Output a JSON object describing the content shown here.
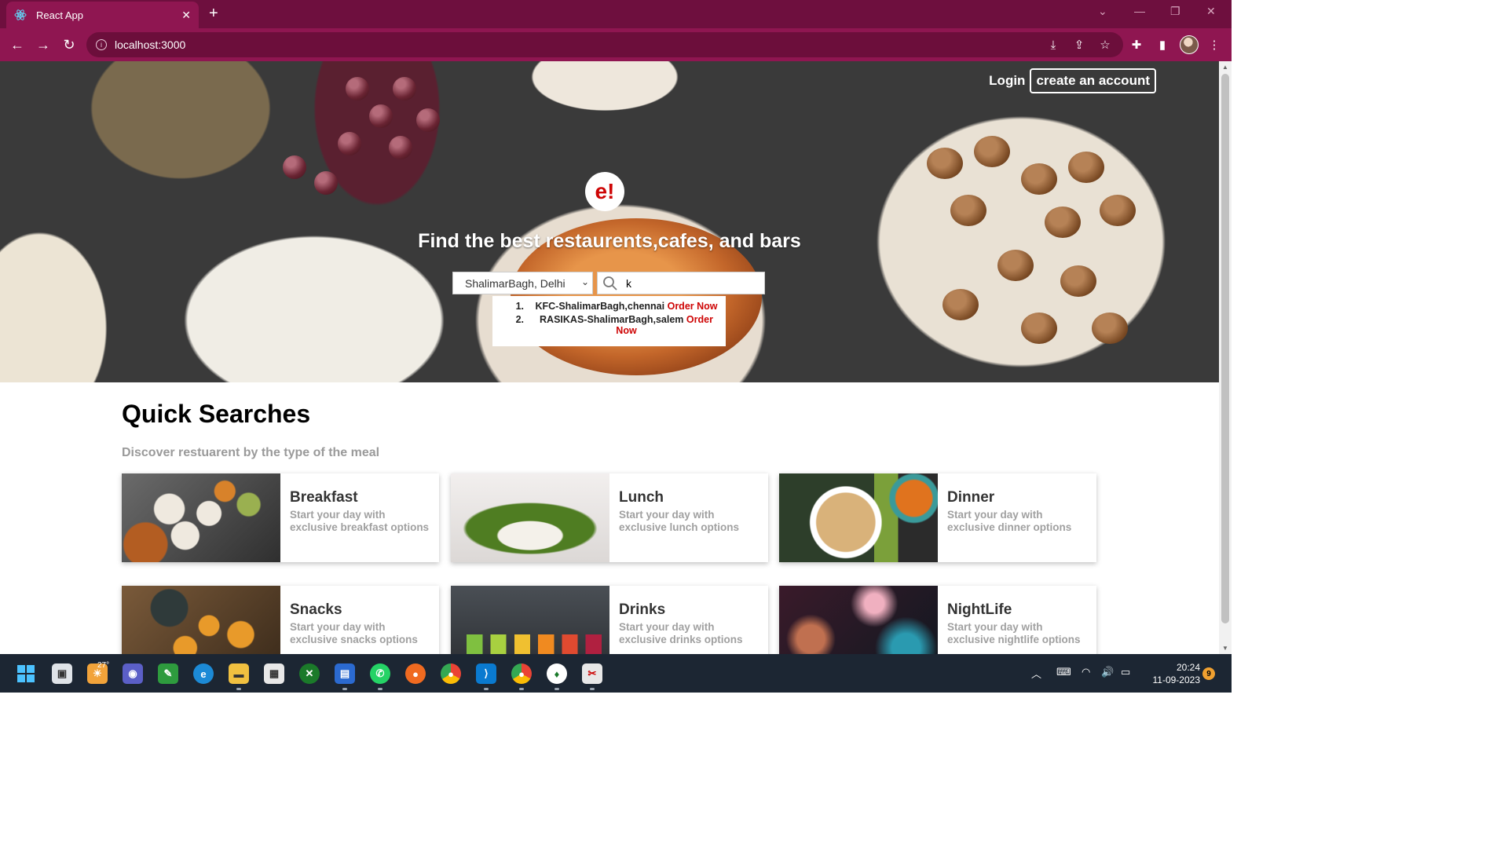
{
  "browser": {
    "tab_title": "React App",
    "url": "localhost:3000"
  },
  "header": {
    "login_label": "Login",
    "create_account_label": "create an account"
  },
  "hero": {
    "logo_text": "e!",
    "title": "Find the best restaurents,cafes, and bars",
    "location_selected": "ShalimarBagh, Delhi",
    "search_value": "k",
    "suggestions": [
      {
        "num": "1.",
        "name": "KFC-ShalimarBagh,chennai",
        "action": "Order Now"
      },
      {
        "num": "2.",
        "name": "RASIKAS-ShalimarBagh,salem",
        "action": "Order Now"
      }
    ]
  },
  "quick_searches": {
    "title": "Quick Searches",
    "subtitle": "Discover restuarent by the type of the meal",
    "cards": [
      {
        "title": "Breakfast",
        "desc": "Start your day with exclusive breakfast options"
      },
      {
        "title": "Lunch",
        "desc": "Start your day with exclusive lunch options"
      },
      {
        "title": "Dinner",
        "desc": "Start your day with exclusive dinner options"
      },
      {
        "title": "Snacks",
        "desc": "Start your day with exclusive snacks options"
      },
      {
        "title": "Drinks",
        "desc": "Start your day with exclusive drinks options"
      },
      {
        "title": "NightLife",
        "desc": "Start your day with exclusive nightlife options"
      }
    ]
  },
  "taskbar": {
    "weather_temp": "27°",
    "time": "20:24",
    "date": "11-09-2023",
    "notification_count": "9"
  },
  "colors": {
    "browser_frame": "#6e0f3e",
    "browser_toolbar": "#8f1651",
    "brand_red": "#ce0505"
  }
}
